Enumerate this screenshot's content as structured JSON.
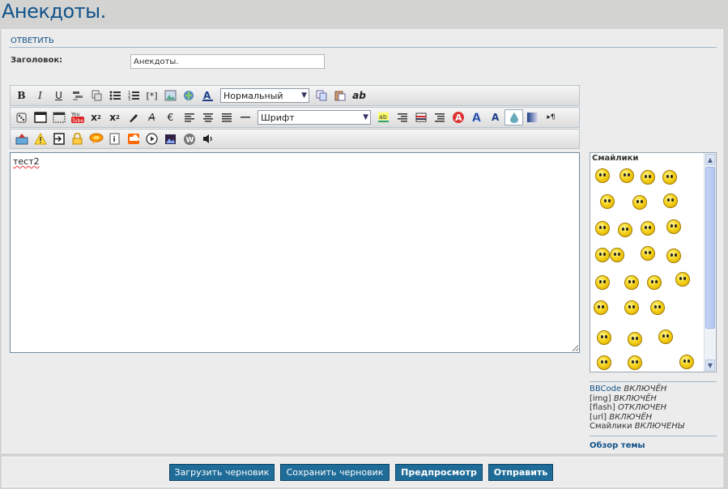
{
  "page": {
    "title": "Анекдоты."
  },
  "form": {
    "reply_heading": "Ответить",
    "subject_label": "Заголовок:",
    "subject_value": "Анекдоты."
  },
  "toolbar": {
    "size_select_value": "Нормальный",
    "font_select_value": "Шрифт",
    "icons_row1": [
      "bold-icon",
      "italic-icon",
      "underline-icon",
      "quote-icon",
      "code-icon",
      "bullet-list-icon",
      "numbered-list-icon",
      "list-item-icon",
      "image-icon",
      "link-icon",
      "font-color-icon"
    ],
    "icons_row1_after": [
      "copy-icon",
      "paste-icon",
      "spellcheck-icon"
    ],
    "icons_row2": [
      "dice-icon",
      "window-icon",
      "spoiler-icon",
      "youtube-icon",
      "superscript-icon",
      "subscript-icon",
      "highlight-icon",
      "strikethrough-icon",
      "euro-icon",
      "align-left-icon",
      "align-center-icon",
      "align-justify-icon",
      "horizontal-rule-icon"
    ],
    "icons_row2_after": [
      "text-background-icon",
      "align-right-icon",
      "flag-icon",
      "indent-icon",
      "font-shadow-icon",
      "font-glow-icon",
      "font-outline-icon",
      "opacity-icon",
      "gradient-icon",
      "direction-icon"
    ],
    "icons_row3": [
      "upload-icon",
      "warning-icon",
      "login-icon",
      "lock-icon",
      "speech-bubble-icon",
      "info-icon",
      "soundcloud-icon",
      "play-icon",
      "picture-icon",
      "wordpress-icon",
      "speaker-icon"
    ]
  },
  "editor": {
    "text": "тест2"
  },
  "smilies": {
    "title": "Смайлики",
    "count": 28
  },
  "status": {
    "bbcode_label": "BBCode",
    "bbcode_state": "ВКЛЮЧЁН",
    "img_label": "[img]",
    "img_state": "ВКЛЮЧЁН",
    "flash_label": "[flash]",
    "flash_state": "ОТКЛЮЧЕН",
    "url_label": "[url]",
    "url_state": "ВКЛЮЧЁН",
    "smilies_label": "Смайлики",
    "smilies_state": "ВКЛЮЧЕНЫ",
    "topic_review": "Обзор темы"
  },
  "buttons": {
    "load_draft": "Загрузить черновик",
    "save_draft": "Сохранить черновик",
    "preview": "Предпросмотр",
    "submit": "Отправить"
  },
  "colors": {
    "accent": "#105289",
    "button": "#1f6c98"
  }
}
